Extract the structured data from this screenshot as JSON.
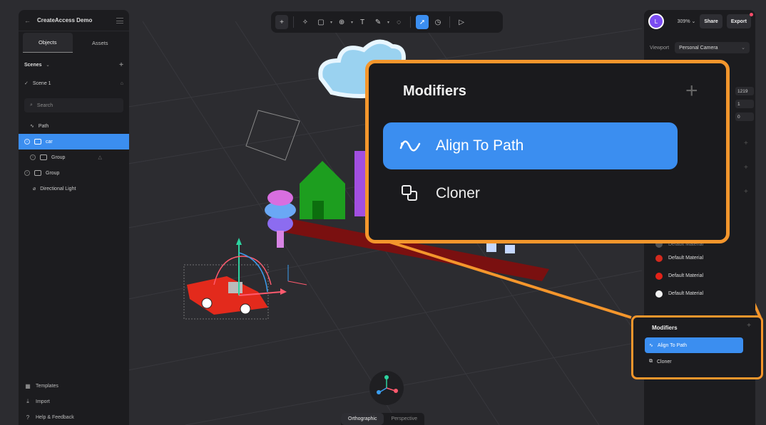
{
  "app": {
    "project_title": "CreateAccess Demo"
  },
  "left_panel": {
    "tabs": [
      {
        "label": "Objects",
        "active": true
      },
      {
        "label": "Assets",
        "active": false
      }
    ],
    "scenes_label": "Scenes",
    "scene_item": "Scene 1",
    "search_placeholder": "Search",
    "tree": [
      {
        "label": "Path",
        "icon": "path-icon",
        "selected": false
      },
      {
        "label": "car",
        "icon": "group-icon",
        "selected": true
      },
      {
        "label": "Group",
        "icon": "group-icon",
        "selected": false
      },
      {
        "label": "Group",
        "icon": "group-icon",
        "selected": false
      },
      {
        "label": "Directional Light",
        "icon": "light-icon",
        "selected": false
      }
    ],
    "bottom": [
      {
        "label": "Templates",
        "icon": "templates-icon"
      },
      {
        "label": "Import",
        "icon": "import-icon"
      },
      {
        "label": "Help & Feedback",
        "icon": "help-icon"
      }
    ]
  },
  "right_panel": {
    "avatar_initial": "L",
    "zoom": "309%",
    "share_label": "Share",
    "export_label": "Export",
    "viewport_label": "Viewport",
    "viewport_value": "Personal Camera",
    "numbers": [
      "1219",
      "1",
      "0"
    ],
    "materials": [
      {
        "label": "Default Material",
        "color": "#d42a1e"
      },
      {
        "label": "Default Material",
        "color": "#e32218"
      },
      {
        "label": "Default Material",
        "color": "#f2f2f2"
      }
    ],
    "partial_material": "Default Material"
  },
  "modifiers_small": {
    "title": "Modifiers",
    "items": [
      {
        "label": "Align To Path",
        "active": true
      },
      {
        "label": "Cloner",
        "active": false
      }
    ]
  },
  "modifiers_big": {
    "title": "Modifiers",
    "items": [
      {
        "label": "Align To Path",
        "active": true
      },
      {
        "label": "Cloner",
        "active": false
      }
    ]
  },
  "view_toggle": [
    {
      "label": "Orthographic",
      "active": true
    },
    {
      "label": "Perspective",
      "active": false
    }
  ],
  "colors": {
    "accent": "#3b8ef0",
    "callout": "#f4962c",
    "panel": "#1c1c1f",
    "viewport": "#2c2c30"
  }
}
